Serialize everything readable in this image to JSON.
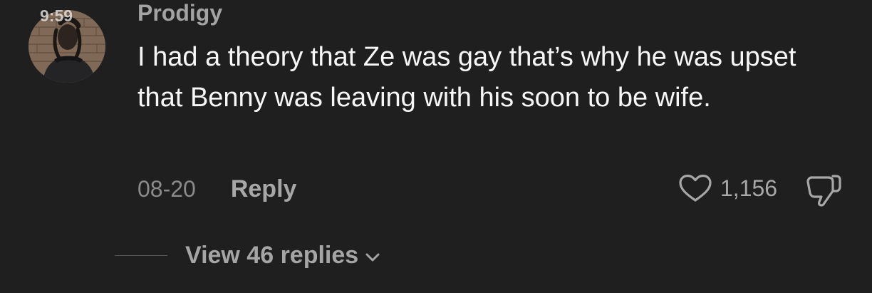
{
  "status_bar": {
    "time": "9:59"
  },
  "comment": {
    "username": "Prodigy",
    "text": "I had a theory that Ze was gay that’s why he was upset that Benny was leaving with his soon to be wife.",
    "date": "08-20",
    "reply_label": "Reply",
    "like_count": "1,156",
    "view_replies_label": "View 46 replies"
  },
  "icons": {
    "like": "heart-outline-icon",
    "dislike": "thumbs-down-icon",
    "expand": "chevron-down-icon"
  },
  "colors": {
    "background": "#1f1f1f",
    "text_primary": "#f7f7f7",
    "text_secondary": "#a3a3a3",
    "text_muted": "#8b8b8b"
  }
}
